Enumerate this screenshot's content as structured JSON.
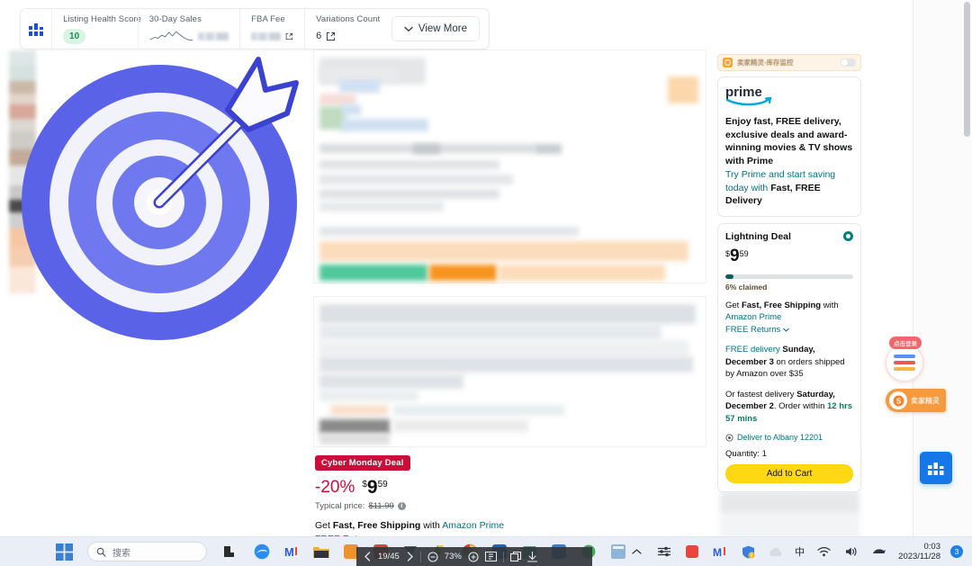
{
  "metric_bar": {
    "icon": "bar-chart-icon",
    "cells": [
      {
        "label": "Listing Health Score",
        "value": "10",
        "type": "pill"
      },
      {
        "label": "30-Day Sales",
        "value": "",
        "type": "sparkline",
        "blurred_value": "Get Plan"
      },
      {
        "label": "FBA Fee",
        "value": "",
        "type": "blurred",
        "blurred_value": "Get Plan"
      },
      {
        "label": "Variations Count",
        "value": "6",
        "type": "number"
      }
    ],
    "view_more_label": "View More"
  },
  "deal": {
    "badge": "Cyber Monday Deal",
    "percent_off": "-20%",
    "currency": "$",
    "price_whole": "9",
    "price_frac": "59",
    "typical_prefix": "Typical price:",
    "typical_price": "$11.99",
    "shipping_prefix": "Get ",
    "shipping_bold": "Fast, Free Shipping",
    "shipping_mid": " with ",
    "shipping_link": "Amazon Prime",
    "returns": "FREE Returns"
  },
  "sidebar": {
    "extension_bar": {
      "label": "卖家精灵-库存监控",
      "icon": "sellersprite-icon",
      "toggle_state": "off"
    },
    "prime": {
      "logo_text": "prime",
      "headline": "Enjoy fast, FREE delivery, exclusive deals and award-winning movies & TV shows with Prime",
      "sub_prefix": "Try Prime and start saving today with ",
      "sub_bold": "Fast, FREE Delivery"
    },
    "lightning_deal": {
      "title": "Lightning Deal",
      "currency": "$",
      "price_whole": "9",
      "price_frac": "59",
      "progress_percent": 6,
      "claimed_label": "6% claimed"
    },
    "shipping": {
      "get_prefix": "Get ",
      "get_bold": "Fast, Free Shipping",
      "get_mid": " with",
      "prime_link": "Amazon Prime",
      "returns": "FREE Returns",
      "free_delivery_prefix": "FREE delivery ",
      "free_delivery_bold": "Sunday, December 3",
      "free_delivery_suffix": " on orders shipped by Amazon over $35",
      "fastest_prefix": "Or fastest delivery ",
      "fastest_bold": "Saturday, December 2",
      "fastest_mid": ". Order within ",
      "fastest_green": "12 hrs 57 mins"
    },
    "deliver_to": "Deliver to Albany 12201",
    "quantity": "Quantity: 1",
    "add_to_cart": "Add to Cart"
  },
  "floating": {
    "login_badge": "点击登录",
    "sellersprite_label": "卖家精灵",
    "blue_button_icon": "bar-chart-icon"
  },
  "pdf_toolbar": {
    "page_indicator": "19/45",
    "zoom_level": "73%",
    "prev_icon": "chevron-left-icon",
    "next_icon": "chevron-right-icon",
    "zoom_out_icon": "zoom-out-icon",
    "zoom_in_icon": "zoom-in-icon",
    "fit_icon": "fit-page-icon",
    "window_icon": "window-icon",
    "download_icon": "download-icon"
  },
  "taskbar": {
    "start_icon": "windows-start-icon",
    "search_placeholder": "搜索",
    "search_icon": "search-icon",
    "ime_indicator": "中",
    "time": "0:03",
    "date": "2023/11/28",
    "notification_count": "3",
    "tray_icons": [
      "chevron-up-icon",
      "settings-sliders-icon",
      "red-app-icon",
      "chart-app-icon",
      "warning-shield-icon",
      "cloud-icon",
      "wifi-icon",
      "volume-icon",
      "input-icon"
    ]
  },
  "colors": {
    "accent_blue": "#5a63e8",
    "prime_blue": "#00a8e1",
    "deal_red": "#cc0c39",
    "cart_yellow": "#ffd814",
    "link_teal": "#007185",
    "green": "#067d62",
    "orange": "#f79a3e"
  }
}
